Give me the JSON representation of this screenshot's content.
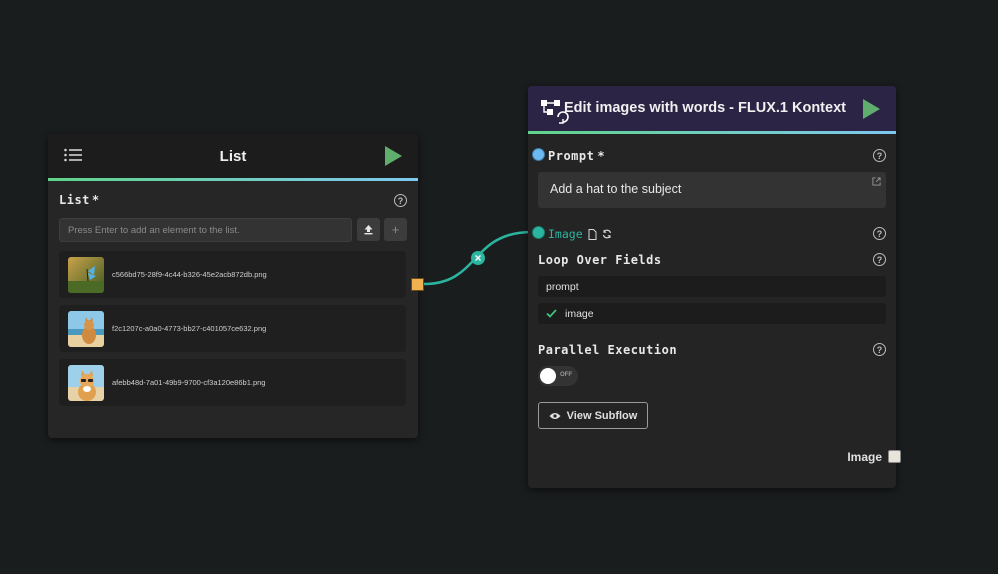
{
  "list_node": {
    "title": "List",
    "field_label": "List",
    "required_mark": "*",
    "input_placeholder": "Press Enter to add an element to the list.",
    "items": [
      {
        "filename": "c566bd75-28f9-4c44-b326-45e2acb872db.png",
        "thumb": "butterfly-on-grass"
      },
      {
        "filename": "f2c1207c-a0a0-4773-bb27-c401057ce632.png",
        "thumb": "cat-on-beach"
      },
      {
        "filename": "afebb48d-7a01-49b9-9700-cf3a120e86b1.png",
        "thumb": "cat-with-sunglasses"
      }
    ],
    "header_accent": "#5fd48a",
    "output_port_color": "#f0b250"
  },
  "edit_node": {
    "title": "Edit images with words - FLUX.1 Kontext",
    "prompt_label": "Prompt",
    "required_mark": "*",
    "prompt_value": "Add a hat to the subject",
    "image_label": "Image",
    "loop_label": "Loop Over Fields",
    "loop_fields": [
      {
        "name": "prompt",
        "checked": false
      },
      {
        "name": "image",
        "checked": true
      }
    ],
    "parallel_label": "Parallel Execution",
    "toggle_state": "OFF",
    "view_subflow_label": "View Subflow",
    "output_label": "Image",
    "header_color": "#2c2444",
    "prompt_port_color": "#6cb8f0",
    "image_port_color": "#2bb5a0"
  },
  "connection": {
    "color": "#2bb5a0"
  }
}
